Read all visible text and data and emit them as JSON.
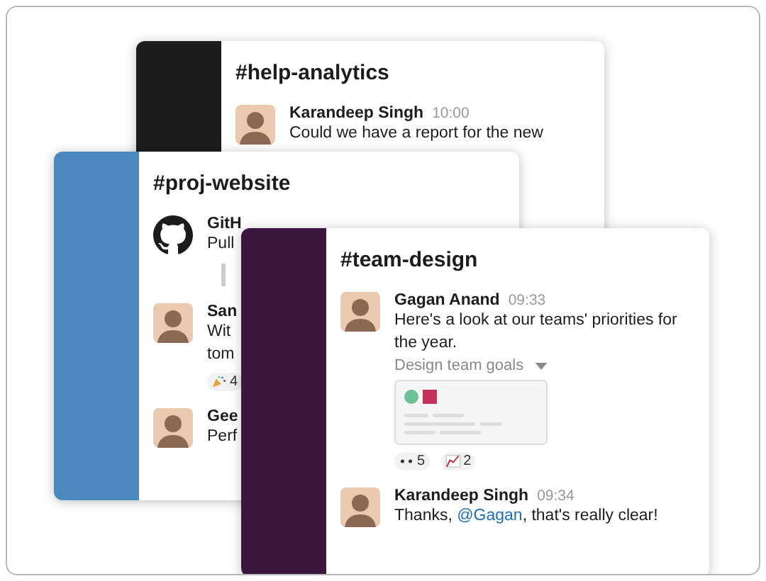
{
  "windows": [
    {
      "channel": "#help-analytics",
      "color": "#1d1c1d",
      "messages": [
        {
          "kind": "person",
          "author": "Karandeep Singh",
          "time": "10:00",
          "lines": [
            "Could we have a report for the new"
          ]
        }
      ]
    },
    {
      "channel": "#proj-website",
      "color": "#4a88bd",
      "messages": [
        {
          "kind": "app",
          "author": "GitH",
          "lines": [
            "Pull"
          ],
          "quote": true
        },
        {
          "kind": "person",
          "author": "San",
          "lines": [
            "Wit",
            "tom"
          ],
          "reactions": [
            {
              "kind": "party",
              "count": "4"
            }
          ]
        },
        {
          "kind": "person",
          "author": "Gee",
          "lines": [
            "Perf"
          ]
        }
      ]
    },
    {
      "channel": "#team-design",
      "color": "#3b1740",
      "messages": [
        {
          "kind": "person",
          "author": "Gagan Anand",
          "time": "09:33",
          "parts": [
            {
              "kind": "plain",
              "text": "Here's a look at our teams' priorities for the year."
            }
          ],
          "attachment": {
            "title": "Design team goals"
          },
          "reactions": [
            {
              "kind": "eyes",
              "count": "5"
            },
            {
              "kind": "chart",
              "count": "2"
            }
          ]
        },
        {
          "kind": "person",
          "author": "Karandeep Singh",
          "time": "09:34",
          "parts": [
            {
              "kind": "plain",
              "text": "Thanks, "
            },
            {
              "kind": "mention",
              "text": "@Gagan"
            },
            {
              "kind": "plain",
              "text": ", that's really clear!"
            }
          ]
        }
      ]
    }
  ]
}
